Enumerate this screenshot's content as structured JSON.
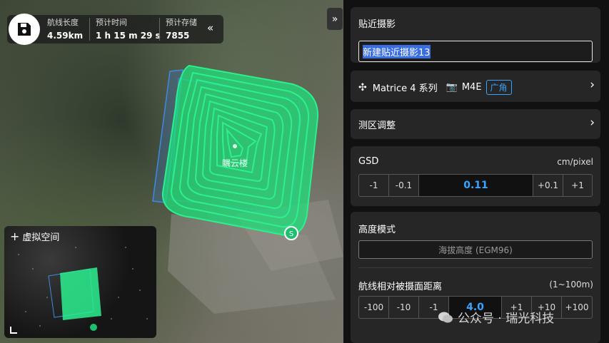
{
  "stats": {
    "route_length_label": "航线长度",
    "route_length_value": "4.59km",
    "est_time_label": "预计时间",
    "est_time_value": "1 h 15 m 29 s",
    "est_storage_label": "预计存储",
    "est_storage_value": "7855"
  },
  "map": {
    "model_label": "瞩云楼",
    "start_marker": "S"
  },
  "mini_view": {
    "title": "虚拟空间"
  },
  "panel": {
    "title": "贴近摄影",
    "mission_name": "新建贴近摄影13",
    "drone": {
      "model": "Matrice 4 系列",
      "camera": "M4E",
      "lens": "广角"
    },
    "area_adjust_label": "测区调整",
    "gsd": {
      "label": "GSD",
      "unit": "cm/pixel",
      "buttons_left": [
        "-1",
        "-0.1"
      ],
      "value": "0.11",
      "buttons_right": [
        "+0.1",
        "+1"
      ]
    },
    "altitude_mode": {
      "label": "高度模式",
      "value": "海拔高度 (EGM96)"
    },
    "distance": {
      "label": "航线相对被摄面距离",
      "range": "(1~100m)",
      "buttons_left": [
        "-100",
        "-10",
        "-1"
      ],
      "value": "4.0",
      "buttons_right": [
        "+1",
        "+10",
        "+100"
      ]
    }
  },
  "watermark": "公众号 · 瑞光科技"
}
